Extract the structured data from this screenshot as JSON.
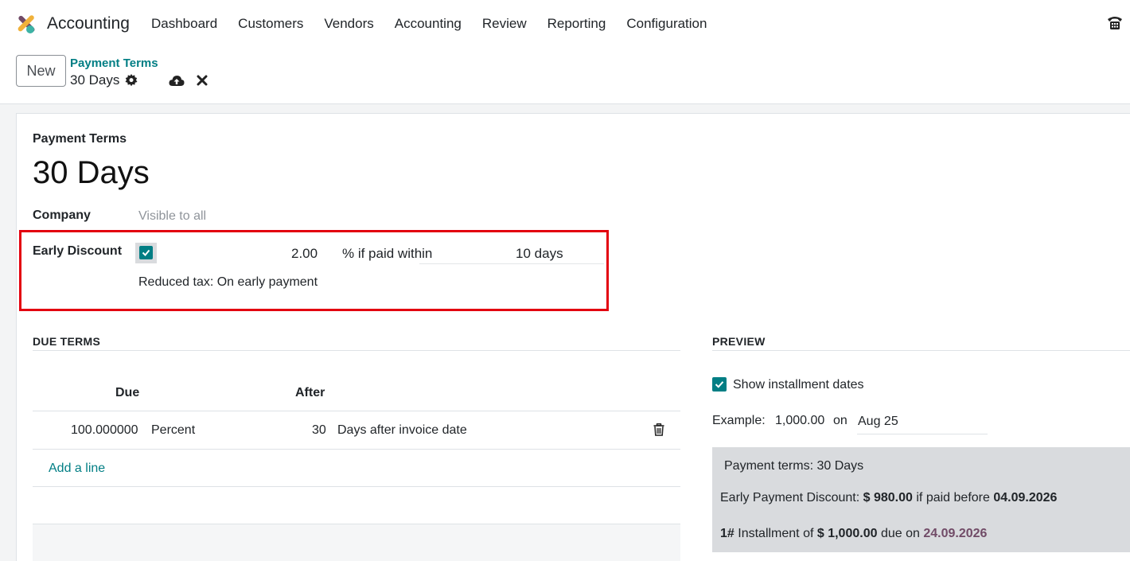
{
  "app": {
    "name": "Accounting"
  },
  "menu": [
    "Dashboard",
    "Customers",
    "Vendors",
    "Accounting",
    "Review",
    "Reporting",
    "Configuration"
  ],
  "icons": {
    "logo": "odoo-app-icon",
    "phone": "phone-icon",
    "gear": "gear-icon",
    "save": "cloud-upload-icon",
    "discard": "close-icon",
    "trash": "trash-icon",
    "check": "check-icon"
  },
  "colors": {
    "accent": "#017e84",
    "highlight": "#e3000f",
    "brand": "#714b67"
  },
  "control": {
    "new_label": "New",
    "breadcrumb_parent": "Payment Terms",
    "breadcrumb_current": "30 Days"
  },
  "form": {
    "section_label": "Payment Terms",
    "title": "30 Days",
    "company_label": "Company",
    "company_placeholder": "Visible to all",
    "early_discount_label": "Early Discount",
    "early_discount_checked": true,
    "discount_pct": "2.00",
    "paid_within_text": "% if paid within",
    "discount_days": "10",
    "days_unit": "days",
    "reduced_tax": "Reduced tax: On early payment"
  },
  "due_terms": {
    "heading": "DUE TERMS",
    "columns": [
      "Due",
      "After"
    ],
    "rows": [
      {
        "due": "100.000000",
        "due_type": "Percent",
        "after": "30",
        "after_type": "Days after invoice date"
      }
    ],
    "add_line": "Add a line"
  },
  "preview": {
    "heading": "PREVIEW",
    "show_installments_label": "Show installment dates",
    "show_installments_checked": true,
    "example_label": "Example:",
    "example_amount": "1,000.00",
    "example_on": "on",
    "example_date": "Aug 25",
    "box_title": "Payment terms: 30 Days",
    "early_prefix": "Early Payment Discount:",
    "early_amount": "$ 980.00",
    "early_mid": "if paid before",
    "early_date": "04.09.2026",
    "inst_number": "1#",
    "inst_prefix": "Installment of",
    "inst_amount": "$ 1,000.00",
    "inst_mid": "due on",
    "inst_date": "24.09.2026"
  }
}
